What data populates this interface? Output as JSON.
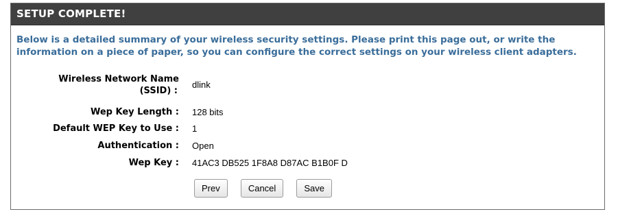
{
  "header": {
    "title": "SETUP COMPLETE!"
  },
  "intro": {
    "text": "Below is a detailed summary of your wireless security settings. Please print this page out, or write the information on a piece of paper, so you can configure the correct settings on your wireless client adapters."
  },
  "summary": {
    "ssid_label_line1": "Wireless Network Name",
    "ssid_label_line2": "(SSID) :",
    "ssid_value": "dlink",
    "key_length_label": "Wep Key Length :",
    "key_length_value": "128 bits",
    "default_key_label": "Default WEP Key to Use :",
    "default_key_value": "1",
    "auth_label": "Authentication :",
    "auth_value": "Open",
    "wep_key_label": "Wep Key :",
    "wep_key_value": "41AC3 DB525 1F8A8 D87AC B1B0F D"
  },
  "buttons": {
    "prev": "Prev",
    "cancel": "Cancel",
    "save": "Save"
  },
  "colors": {
    "header_bg": "#404040",
    "intro_text": "#3a6d9a"
  }
}
